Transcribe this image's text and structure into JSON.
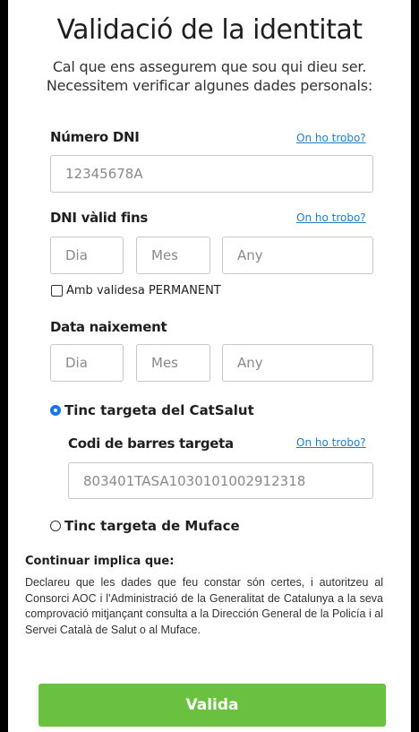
{
  "title": "Validació de la identitat",
  "subtitle": {
    "line1": "Cal que ens assegurem que sou qui dieu ser.",
    "line2": "Necessitem verificar algunes dades personals:"
  },
  "dni": {
    "label": "Número DNI",
    "help_link": "On ho trobo?",
    "placeholder": "12345678A"
  },
  "dni_valid": {
    "label": "DNI vàlid fins",
    "help_link": "On ho trobo?",
    "day_placeholder": "Dia",
    "month_placeholder": "Mes",
    "year_placeholder": "Any",
    "permanent_label": "Amb validesa PERMANENT",
    "permanent_checked": false
  },
  "birth": {
    "label": "Data naixement",
    "day_placeholder": "Dia",
    "month_placeholder": "Mes",
    "year_placeholder": "Any"
  },
  "catsalut": {
    "radio_label": "Tinc targeta del CatSalut",
    "checked": true,
    "barcode_label": "Codi de barres targeta",
    "help_link": "On ho trobo?",
    "barcode_placeholder": "803401TASA1030101002912318"
  },
  "muface": {
    "radio_label": "Tinc targeta de Muface",
    "checked": false
  },
  "consent": {
    "title": "Continuar implica que:",
    "text": "Declareu que les dades que feu constar són certes, i autoritzeu al Consorci AOC i l'Administració de la Generalitat de Catalunya a la seva comprovació mitjançant consulta a la Dirección General de la Policía i al Servei Català de Salut o al Muface."
  },
  "submit_label": "Valida",
  "colors": {
    "accent_green": "#6ac13f",
    "link_blue": "#1f7ec6",
    "radio_blue": "#1a73e8"
  }
}
